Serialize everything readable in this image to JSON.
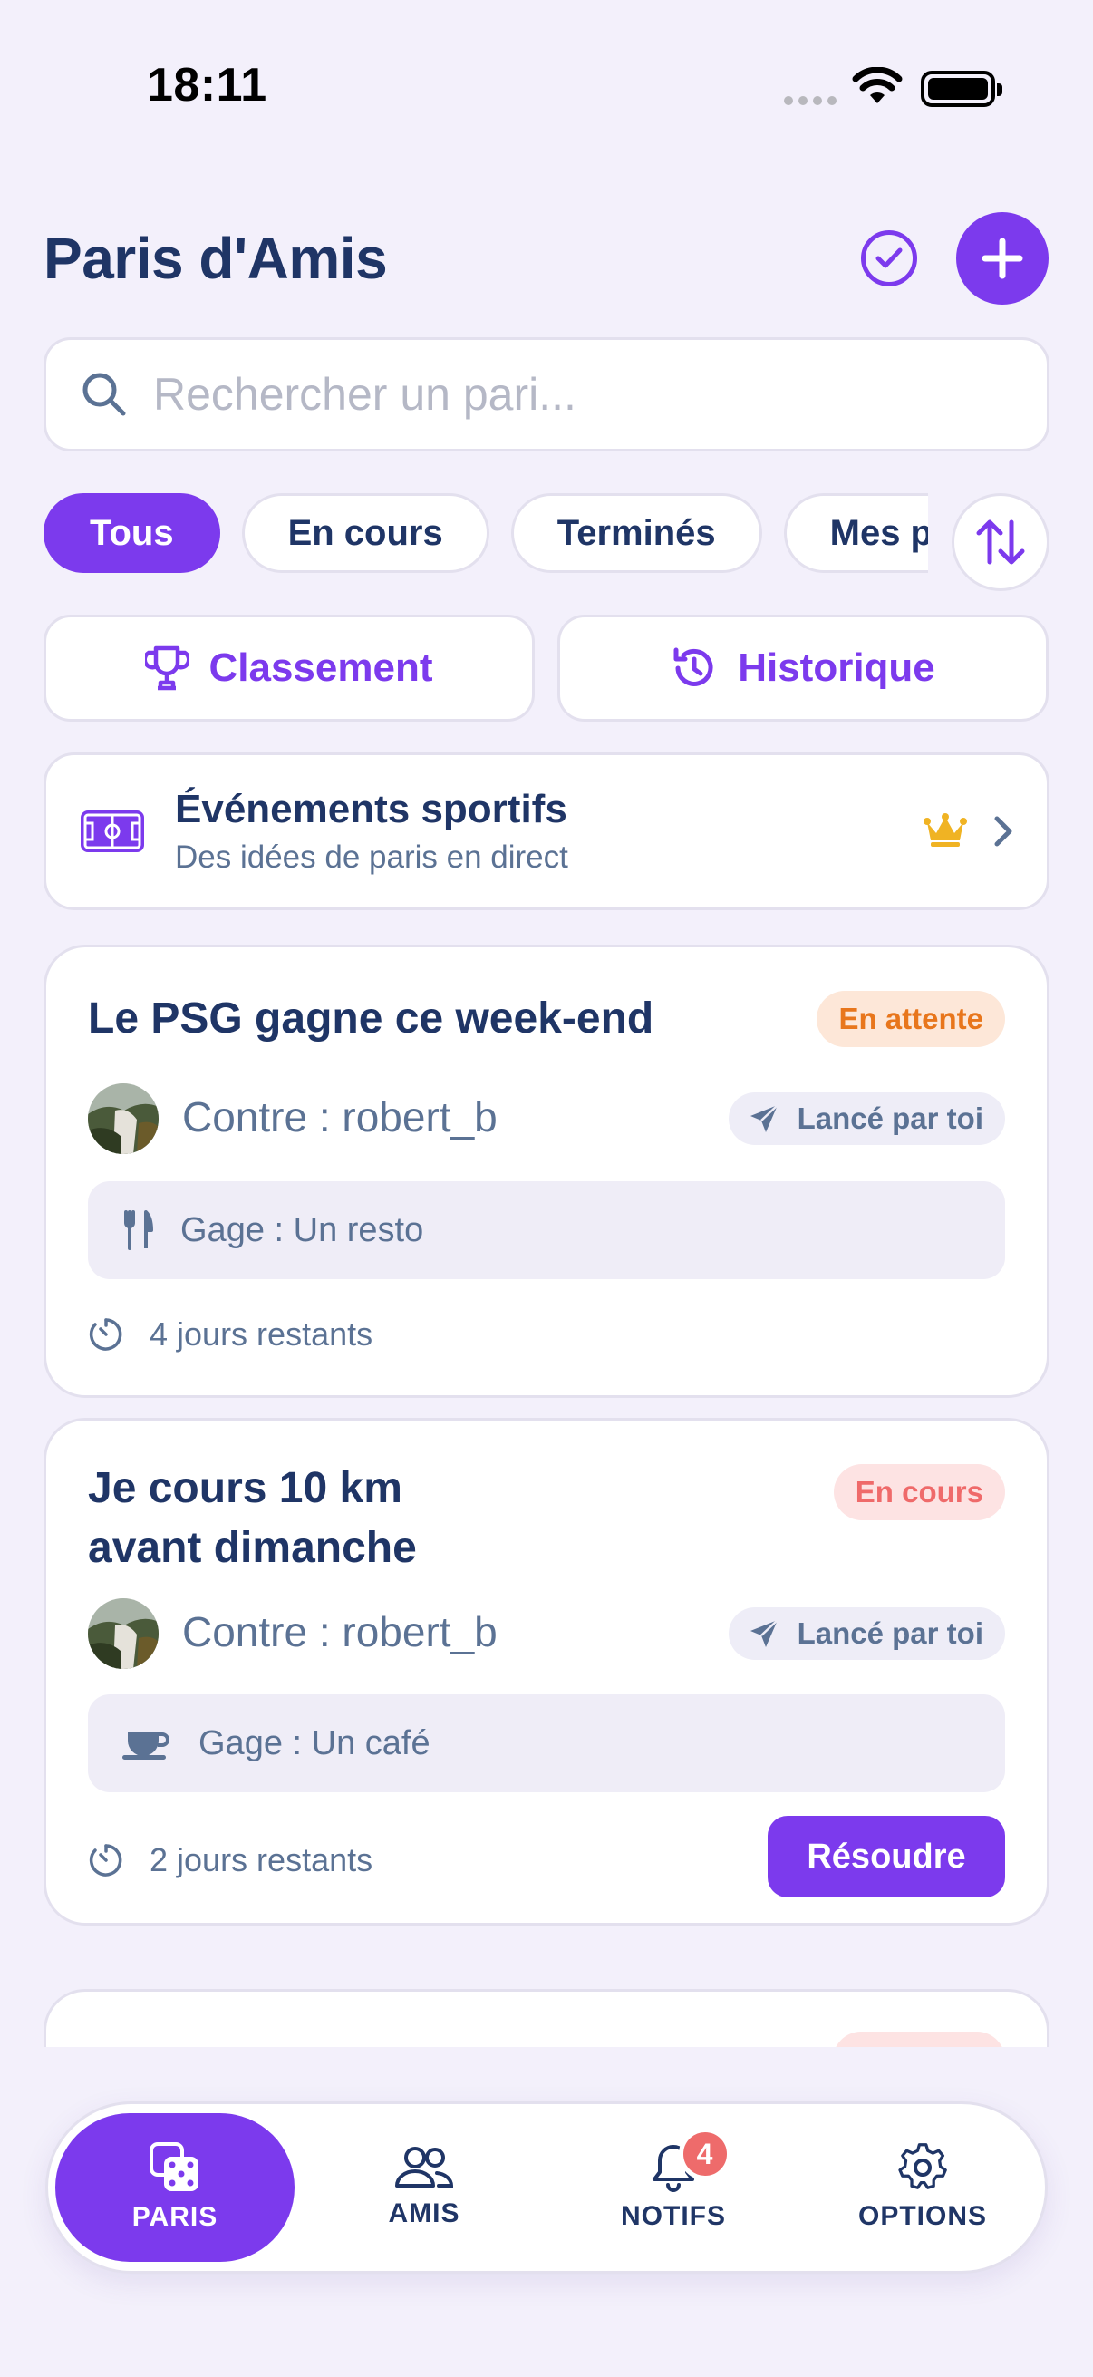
{
  "status_bar": {
    "time": "18:11"
  },
  "header": {
    "title": "Paris d'Amis"
  },
  "search": {
    "placeholder": "Rechercher un pari..."
  },
  "filters": [
    {
      "label": "Tous",
      "active": true
    },
    {
      "label": "En cours",
      "active": false
    },
    {
      "label": "Terminés",
      "active": false
    },
    {
      "label": "Mes paris",
      "active": false
    }
  ],
  "actions": {
    "classement": "Classement",
    "historique": "Historique"
  },
  "events_banner": {
    "title": "Événements sportifs",
    "subtitle": "Des idées de paris en direct"
  },
  "bets": [
    {
      "title": "Le PSG gagne ce week-end",
      "status": "En attente",
      "opponent": "Contre : robert_b",
      "launched": "Lancé par toi",
      "pledge": "Gage : Un resto",
      "pledge_icon": "fork-knife-icon",
      "time_left": "4 jours restants"
    },
    {
      "title": "Je cours 10 km avant dimanche",
      "status": "En cours",
      "opponent": "Contre : robert_b",
      "launched": "Lancé par toi",
      "pledge": "Gage : Un café",
      "pledge_icon": "coffee-cup-icon",
      "time_left": "2 jours restants",
      "resolve_label": "Résoudre"
    }
  ],
  "nav": {
    "paris": "PARIS",
    "amis": "AMIS",
    "notifs": "NOTIFS",
    "notifs_badge": "4",
    "options": "OPTIONS"
  },
  "colors": {
    "accent": "#7c3aed",
    "title": "#1f3566",
    "muted": "#5b7294",
    "background": "#f3f0fb",
    "badge_wait": "#e8761c",
    "badge_live": "#ef6a6a"
  }
}
